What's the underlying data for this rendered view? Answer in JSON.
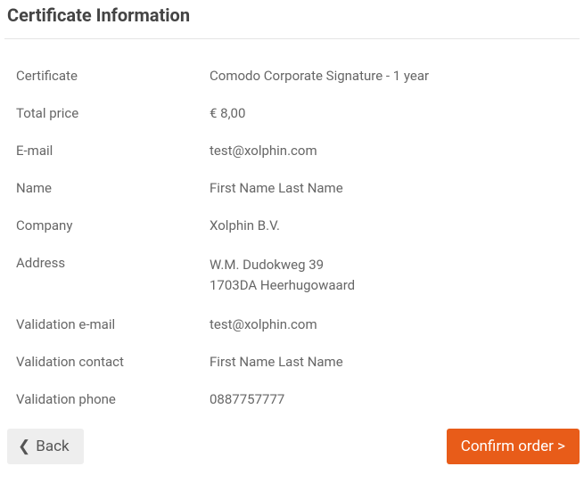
{
  "title": "Certificate Information",
  "rows": {
    "certificate": {
      "label": "Certificate",
      "value": "Comodo Corporate Signature - 1 year"
    },
    "total_price": {
      "label": "Total price",
      "value": "€ 8,00"
    },
    "email": {
      "label": "E-mail",
      "value": "test@xolphin.com"
    },
    "name": {
      "label": "Name",
      "value": "First Name Last Name"
    },
    "company": {
      "label": "Company",
      "value": "Xolphin B.V."
    },
    "address": {
      "label": "Address",
      "line1": "W.M. Dudokweg 39",
      "line2": "1703DA Heerhugowaard"
    },
    "validation_email": {
      "label": "Validation e-mail",
      "value": "test@xolphin.com"
    },
    "validation_contact": {
      "label": "Validation contact",
      "value": "First Name Last Name"
    },
    "validation_phone": {
      "label": "Validation phone",
      "value": "0887757777"
    }
  },
  "buttons": {
    "back": "Back",
    "confirm": "Confirm order >"
  }
}
